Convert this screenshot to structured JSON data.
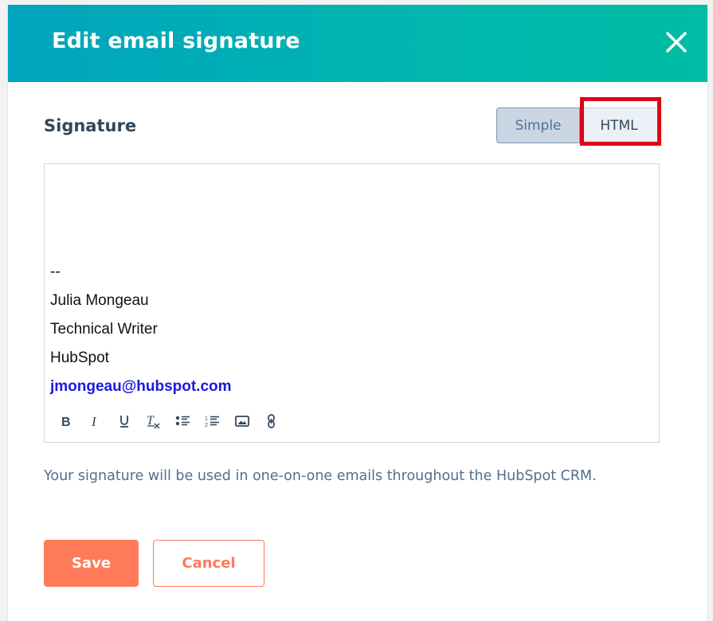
{
  "modal": {
    "title": "Edit email signature",
    "close_icon": "close-icon"
  },
  "signature_section": {
    "label": "Signature",
    "mode_toggle": {
      "options": [
        {
          "label": "Simple",
          "selected": true
        },
        {
          "label": "HTML",
          "selected": false,
          "highlighted": true
        }
      ]
    }
  },
  "editor": {
    "lines": [
      "--",
      "Julia Mongeau",
      "Technical Writer",
      "HubSpot"
    ],
    "email": "jmongeau@hubspot.com",
    "toolbar": [
      {
        "icon": "bold-icon"
      },
      {
        "icon": "italic-icon"
      },
      {
        "icon": "underline-icon"
      },
      {
        "icon": "clear-formatting-icon"
      },
      {
        "icon": "bulleted-list-icon"
      },
      {
        "icon": "numbered-list-icon"
      },
      {
        "icon": "image-icon"
      },
      {
        "icon": "link-icon"
      }
    ]
  },
  "help_text": "Your signature will be used in one-on-one emails throughout the HubSpot CRM.",
  "actions": {
    "save_label": "Save",
    "cancel_label": "Cancel"
  },
  "colors": {
    "header_gradient_start": "#00a4bd",
    "header_gradient_end": "#00bda5",
    "primary_button": "#ff7a59",
    "highlight_box": "#e2001a",
    "email_link": "#1a1ae0"
  }
}
